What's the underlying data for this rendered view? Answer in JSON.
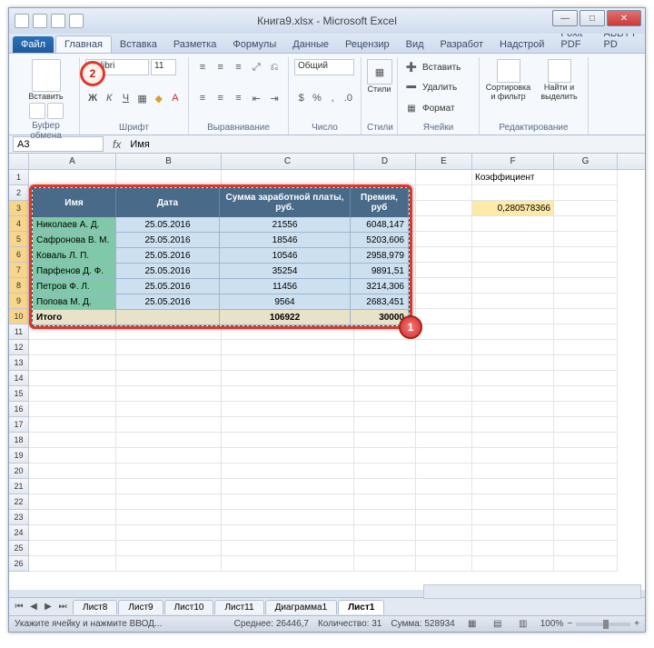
{
  "window_title": "Книга9.xlsx - Microsoft Excel",
  "tabs": {
    "file": "Файл",
    "items": [
      "Главная",
      "Вставка",
      "Разметка",
      "Формулы",
      "Данные",
      "Рецензир",
      "Вид",
      "Разработ",
      "Надстрой",
      "Foxit PDF",
      "ABBYY PD"
    ],
    "active": "Главная"
  },
  "ribbon": {
    "clipboard": {
      "label": "Буфер обмена",
      "paste": "Вставить"
    },
    "font": {
      "label": "Шрифт",
      "family": "Calibri",
      "size": "11"
    },
    "alignment": {
      "label": "Выравнивание"
    },
    "number": {
      "label": "Число",
      "format": "Общий"
    },
    "styles": {
      "label": "Стили",
      "btn": "Стили"
    },
    "cells": {
      "label": "Ячейки",
      "insert": "Вставить",
      "delete": "Удалить",
      "format": "Формат"
    },
    "editing": {
      "label": "Редактирование",
      "sort": "Сортировка и фильтр",
      "find": "Найти и выделить"
    }
  },
  "namebox": "A3",
  "formula": "Имя",
  "columns": [
    "A",
    "B",
    "C",
    "D",
    "E",
    "F",
    "G"
  ],
  "side": {
    "coef_label": "Коэффициент",
    "coef_value": "0,280578366"
  },
  "table": {
    "headers": [
      "Имя",
      "Дата",
      "Сумма заработной платы, руб.",
      "Премия, руб"
    ],
    "rows": [
      {
        "n": "Николаев А. Д.",
        "d": "25.05.2016",
        "s": "21556",
        "p": "6048,147"
      },
      {
        "n": "Сафронова В. М.",
        "d": "25.05.2016",
        "s": "18546",
        "p": "5203,606"
      },
      {
        "n": "Коваль Л. П.",
        "d": "25.05.2016",
        "s": "10546",
        "p": "2958,979"
      },
      {
        "n": "Парфенов Д. Ф.",
        "d": "25.05.2016",
        "s": "35254",
        "p": "9891,51"
      },
      {
        "n": "Петров Ф. Л.",
        "d": "25.05.2016",
        "s": "11456",
        "p": "3214,306"
      },
      {
        "n": "Попова М. Д.",
        "d": "25.05.2016",
        "s": "9564",
        "p": "2683,451"
      }
    ],
    "total": {
      "label": "Итого",
      "sum": "106922",
      "prem": "30000"
    }
  },
  "row_numbers_visible": 26,
  "callouts": {
    "one": "1",
    "two": "2"
  },
  "sheets": {
    "items": [
      "Лист8",
      "Лист9",
      "Лист10",
      "Лист11",
      "Диаграмма1",
      "Лист1"
    ],
    "active": "Лист1"
  },
  "status": {
    "left": "Укажите ячейку и нажмите ВВОД...",
    "avg_label": "Среднее:",
    "avg": "26446,7",
    "count_label": "Количество:",
    "count": "31",
    "sum_label": "Сумма:",
    "sum": "528934",
    "zoom": "100%"
  }
}
